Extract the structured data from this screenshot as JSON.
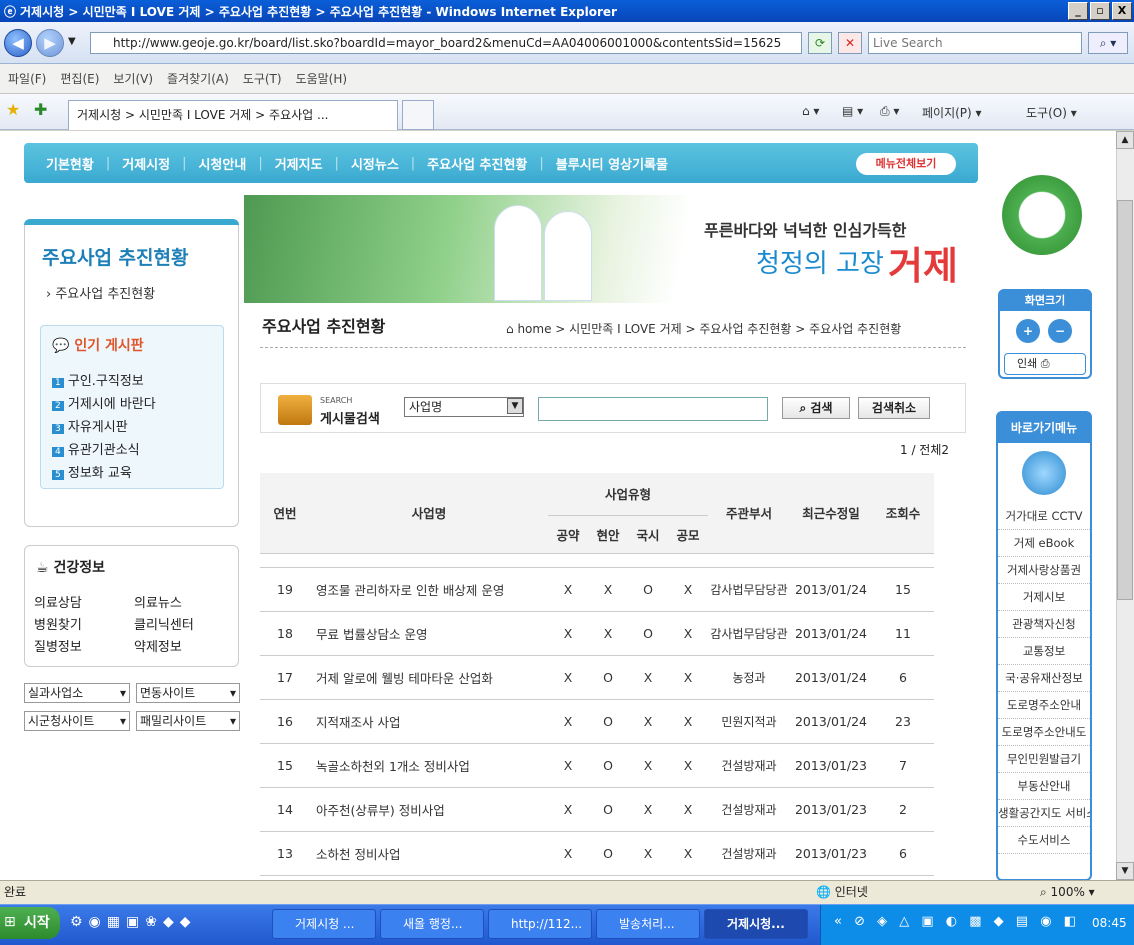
{
  "window": {
    "title": "거제시청 > 시민만족 I LOVE 거제 > 주요사업 추진현황 > 주요사업 추진현황 - Windows Internet Explorer",
    "minimize": "_",
    "maximize": "▫",
    "close": "X"
  },
  "address": {
    "url": "http://www.geoje.go.kr/board/list.sko?boardId=mayor_board2&menuCd=AA04006001000&contentsSid=15625",
    "live_search_placeholder": "Live Search"
  },
  "menu": [
    "파일(F)",
    "편집(E)",
    "보기(V)",
    "즐겨찾기(A)",
    "도구(T)",
    "도움말(H)"
  ],
  "tab": {
    "label": "거제시청 > 시민만족 I LOVE 거제 > 주요사업 ...",
    "page_cmd": "페이지(P) ▾",
    "tools_cmd": "도구(O) ▾"
  },
  "site": {
    "topnav": [
      "기본현황",
      "거제시정",
      "시청안내",
      "거제지도",
      "시정뉴스",
      "주요사업 추진현황",
      "블루시티 영상기록물"
    ],
    "all_menu": "메뉴전체보기",
    "left_title": "주요사업 추진현황",
    "left_sub": "주요사업 추진현황",
    "popular_title": "인기 게시판",
    "popular_items": [
      "구인.구직정보",
      "거제시에 바란다",
      "자유게시판",
      "유관기관소식",
      "정보화 교육"
    ],
    "health_title": "건강정보",
    "health_items": [
      "의료상담",
      "의료뉴스",
      "병원찾기",
      "클리닉센터",
      "질병정보",
      "약제정보"
    ],
    "dropdowns": [
      "실과사업소",
      "면동사이트",
      "시군청사이트",
      "패밀리사이트"
    ],
    "banner_line1": "푸른바다와 넉넉한 인심가득한",
    "banner_line2": "청정의 고장",
    "banner_geoje": "거제",
    "page_title": "주요사업 추진현황",
    "breadcrumb": "home > 시민만족 I LOVE 거제 > 주요사업 추진현황 > 주요사업 추진현황",
    "search_label_small": "SEARCH",
    "search_label": "게시물검색",
    "search_select": "사업명",
    "search_btn": "검색",
    "cancel_btn": "검색취소",
    "page_info": "1 / 전체2",
    "columns": {
      "no": "연번",
      "name": "사업명",
      "type": "사업유형",
      "t1": "공약",
      "t2": "현안",
      "t3": "국시",
      "t4": "공모",
      "dept": "주관부서",
      "date": "최근수정일",
      "views": "조회수"
    },
    "rows": [
      [
        "19",
        "영조물 관리하자로 인한 배상제 운영",
        "X",
        "X",
        "O",
        "X",
        "감사법무담당관",
        "2013/01/24",
        "15"
      ],
      [
        "18",
        "무료 법률상담소 운영",
        "X",
        "X",
        "O",
        "X",
        "감사법무담당관",
        "2013/01/24",
        "11"
      ],
      [
        "17",
        "거제 알로에 웰빙 테마타운 산업화",
        "X",
        "O",
        "X",
        "X",
        "농정과",
        "2013/01/24",
        "6"
      ],
      [
        "16",
        "지적재조사 사업",
        "X",
        "O",
        "X",
        "X",
        "민원지적과",
        "2013/01/24",
        "23"
      ],
      [
        "15",
        "녹골소하천외 1개소 정비사업",
        "X",
        "O",
        "X",
        "X",
        "건설방재과",
        "2013/01/23",
        "7"
      ],
      [
        "14",
        "아주천(상류부) 정비사업",
        "X",
        "O",
        "X",
        "X",
        "건설방재과",
        "2013/01/23",
        "2"
      ],
      [
        "13",
        "소하천 정비사업",
        "X",
        "O",
        "X",
        "X",
        "건설방재과",
        "2013/01/23",
        "6"
      ]
    ],
    "screen_size": "화면크기",
    "print": "인쇄",
    "quick_title": "바로가기메뉴",
    "quick_items": [
      "거가대로 CCTV",
      "거제 eBook",
      "거제사랑상품권",
      "거제시보",
      "관광책자신청",
      "교통정보",
      "국·공유재산정보",
      "도로명주소안내",
      "도로명주소안내도",
      "무인민원발급기",
      "부동산안내",
      "생활공간지도 서비스",
      "수도서비스"
    ]
  },
  "status": {
    "left": "완료",
    "zone": "인터넷",
    "zoom": "100%"
  },
  "taskbar": {
    "start": "시작",
    "tasks": [
      "거제시청 ...",
      "새올 행정...",
      "http://112...",
      "발송처리...",
      "거제시청..."
    ],
    "clock": "08:45"
  }
}
